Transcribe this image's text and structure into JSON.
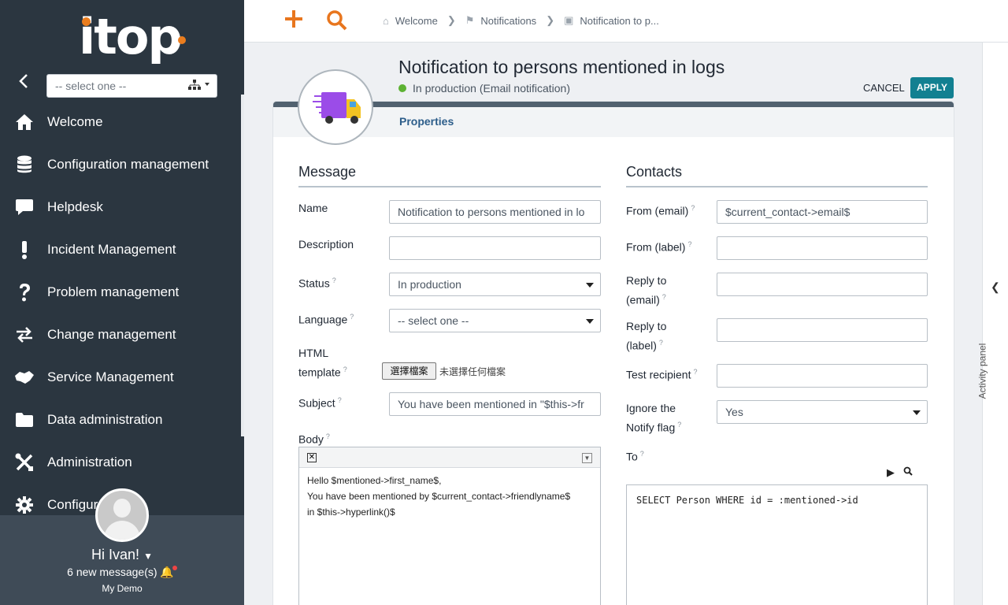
{
  "sidebar": {
    "logo_text": "itop",
    "org_select_placeholder": "-- select one --",
    "menu": [
      {
        "label": "Welcome",
        "icon": "home-icon"
      },
      {
        "label": "Configuration management",
        "icon": "database-icon"
      },
      {
        "label": "Helpdesk",
        "icon": "chat-icon"
      },
      {
        "label": "Incident Management",
        "icon": "exclamation-icon"
      },
      {
        "label": "Problem management",
        "icon": "question-icon"
      },
      {
        "label": "Change management",
        "icon": "exchange-icon"
      },
      {
        "label": "Service Management",
        "icon": "handshake-icon"
      },
      {
        "label": "Data administration",
        "icon": "folder-icon"
      },
      {
        "label": "Administration",
        "icon": "tools-icon"
      },
      {
        "label": "Configur",
        "icon": "gear-icon"
      }
    ],
    "user": {
      "greeting": "Hi Ivan!",
      "messages": "6 new message(s)",
      "org": "My Demo"
    }
  },
  "topbar": {
    "breadcrumb": [
      "Welcome",
      "Notifications",
      "Notification to p..."
    ]
  },
  "header": {
    "title": "Notification to persons mentioned in logs",
    "status": "In production",
    "type": "(Email notification)",
    "cancel_label": "CANCEL",
    "apply_label": "APPLY",
    "tab": "Properties"
  },
  "activity_panel": {
    "label": "Activity panel"
  },
  "message": {
    "section_title": "Message",
    "name_label": "Name",
    "name_value": "Notification to persons mentioned in lo",
    "description_label": "Description",
    "description_value": "",
    "status_label": "Status",
    "status_value": "In production",
    "language_label": "Language",
    "language_value": "-- select one --",
    "html_template_label_1": "HTML",
    "html_template_label_2": "template",
    "file_button": "選擇檔案",
    "file_none": "未選擇任何檔案",
    "subject_label": "Subject",
    "subject_value": "You have been mentioned in \"$this->fr",
    "body_label": "Body",
    "body_lines": [
      "Hello $mentioned->first_name$,",
      "You have been mentioned by $current_contact->friendlyname$",
      "in $this->hyperlink()$"
    ]
  },
  "contacts": {
    "section_title": "Contacts",
    "from_email_label": "From (email)",
    "from_email_value": "$current_contact->email$",
    "from_label_label": "From (label)",
    "reply_email_label_1": "Reply to",
    "reply_email_label_2": "(email)",
    "reply_label_label_1": "Reply to",
    "reply_label_label_2": "(label)",
    "test_recipient_label": "Test recipient",
    "ignore_notify_label_1": "Ignore the",
    "ignore_notify_label_2": "Notify flag",
    "ignore_notify_value": "Yes",
    "to_label": "To",
    "to_query": "SELECT Person WHERE id = :mentioned->id"
  },
  "colors": {
    "sidebar_bg": "#2b3640",
    "accent_orange": "#ea7d1e",
    "apply_teal": "#128091",
    "status_green": "#5db233"
  }
}
